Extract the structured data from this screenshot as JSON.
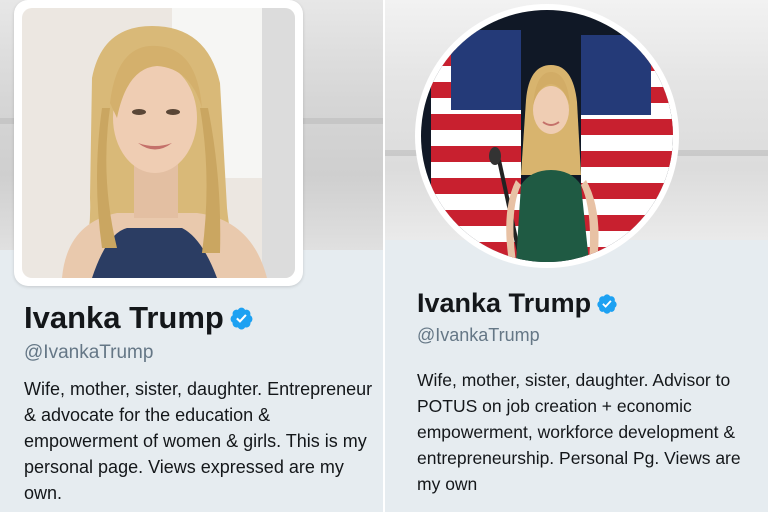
{
  "profiles": [
    {
      "name": "Ivanka Trump",
      "handle": "@IvankaTrump",
      "bio": "Wife, mother, sister, daughter. Entrepreneur & advocate for the education & empowerment of women & girls. This is my personal page. Views expressed are my own."
    },
    {
      "name": "Ivanka Trump",
      "handle": "@IvankaTrump",
      "bio": "Wife, mother, sister, daughter. Advisor to POTUS on job creation + economic empowerment, workforce development & entrepreneurship. Personal Pg. Views are my own"
    }
  ],
  "colors": {
    "verified_badge": "#1da1f2",
    "profile_background": "#e6ecf0",
    "name_text": "#14171a",
    "handle_text": "#657786"
  },
  "icons": {
    "verified": "verified-badge-icon"
  }
}
